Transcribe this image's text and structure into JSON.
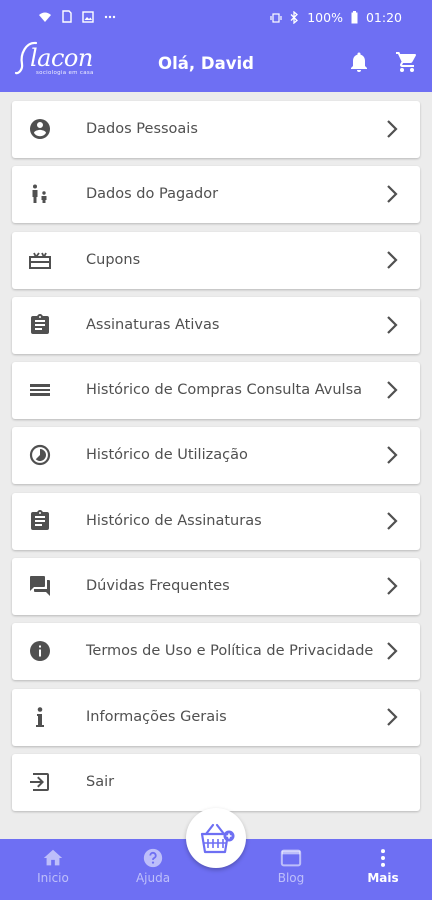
{
  "status_bar": {
    "battery": "100%",
    "time": "01:20"
  },
  "header": {
    "logo_text": "lacon",
    "logo_tagline": "sociologia em casa",
    "greeting": "Olá, David"
  },
  "menu": {
    "items": [
      {
        "label": "Dados Pessoais",
        "icon": "account-circle-icon"
      },
      {
        "label": "Dados do Pagador",
        "icon": "family-icon"
      },
      {
        "label": "Cupons",
        "icon": "coupon-icon"
      },
      {
        "label": "Assinaturas Ativas",
        "icon": "clipboard-icon"
      },
      {
        "label": "Histórico de Compras Consulta Avulsa",
        "icon": "list-icon"
      },
      {
        "label": "Histórico de Utilização",
        "icon": "timelapse-icon"
      },
      {
        "label": "Histórico de Assinaturas",
        "icon": "clipboard-icon"
      },
      {
        "label": "Dúvidas Frequentes",
        "icon": "forum-icon"
      },
      {
        "label": "Termos de Uso e Política de Privacidade",
        "icon": "info-icon"
      },
      {
        "label": "Informações Gerais",
        "icon": "info-i-icon"
      },
      {
        "label": "Sair",
        "icon": "exit-icon"
      }
    ]
  },
  "bottom_nav": {
    "inicio": "Inicio",
    "ajuda": "Ajuda",
    "blog": "Blog",
    "mais": "Mais",
    "active": "mais"
  },
  "colors": {
    "primary": "#6e6ff3",
    "background": "#ececec",
    "icon": "#505050"
  }
}
